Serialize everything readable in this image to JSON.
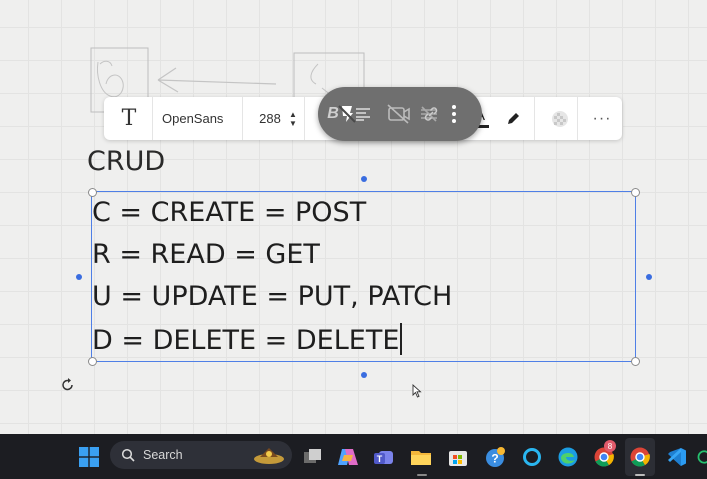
{
  "canvas": {
    "heading": "CRUD",
    "lines": [
      "C = CREATE = POST",
      "R = READ = GET",
      "U = UPDATE = PUT, PATCH",
      "D = DELETE = DELETE"
    ]
  },
  "toolbar": {
    "text_icon": "T",
    "font_name": "OpenSans",
    "font_size": "288",
    "bold_glyph": "B",
    "color_glyph": "A",
    "more_glyph": "···",
    "text_color": "#222222"
  },
  "taskbar": {
    "search_label": "Search",
    "chrome_badge": "8",
    "bg": "#1c1d22"
  },
  "colors": {
    "selection": "#4f7fe6",
    "overlay_pill": "#6f6f6f"
  }
}
